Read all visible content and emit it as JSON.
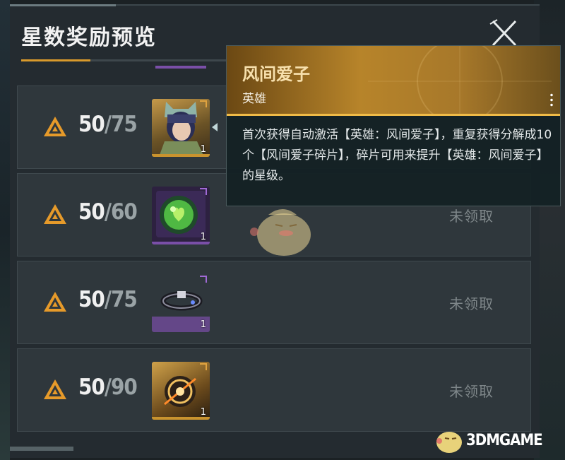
{
  "panel": {
    "title": "星数奖励预览"
  },
  "rows": [
    {
      "current": "50",
      "separator": "/",
      "required": "75",
      "status": "",
      "reward_qty": "1",
      "reward_icon": "hero-portrait-icon"
    },
    {
      "current": "50",
      "separator": "/",
      "required": "60",
      "status": "未领取",
      "reward_qty": "1",
      "reward_icon": "green-orb-icon"
    },
    {
      "current": "50",
      "separator": "/",
      "required": "75",
      "status": "未领取",
      "reward_qty": "1",
      "reward_icon": "ring-accessory-icon"
    },
    {
      "current": "50",
      "separator": "/",
      "required": "90",
      "status": "未领取",
      "reward_qty": "1",
      "reward_icon": "gold-crystal-icon"
    }
  ],
  "tooltip": {
    "name": "风间爱子",
    "type": "英雄",
    "description": "首次获得自动激活【英雄：风间爱子】，重复获得分解成10个【风间爱子碎片】，碎片可用来提升【英雄：风间爱子】的星级。"
  },
  "watermark": {
    "text": "3DMGAME"
  },
  "colors": {
    "accent_gold": "#d99a2c",
    "rare_purple": "#7a4fa8",
    "epic_gold": "#c9932e"
  }
}
